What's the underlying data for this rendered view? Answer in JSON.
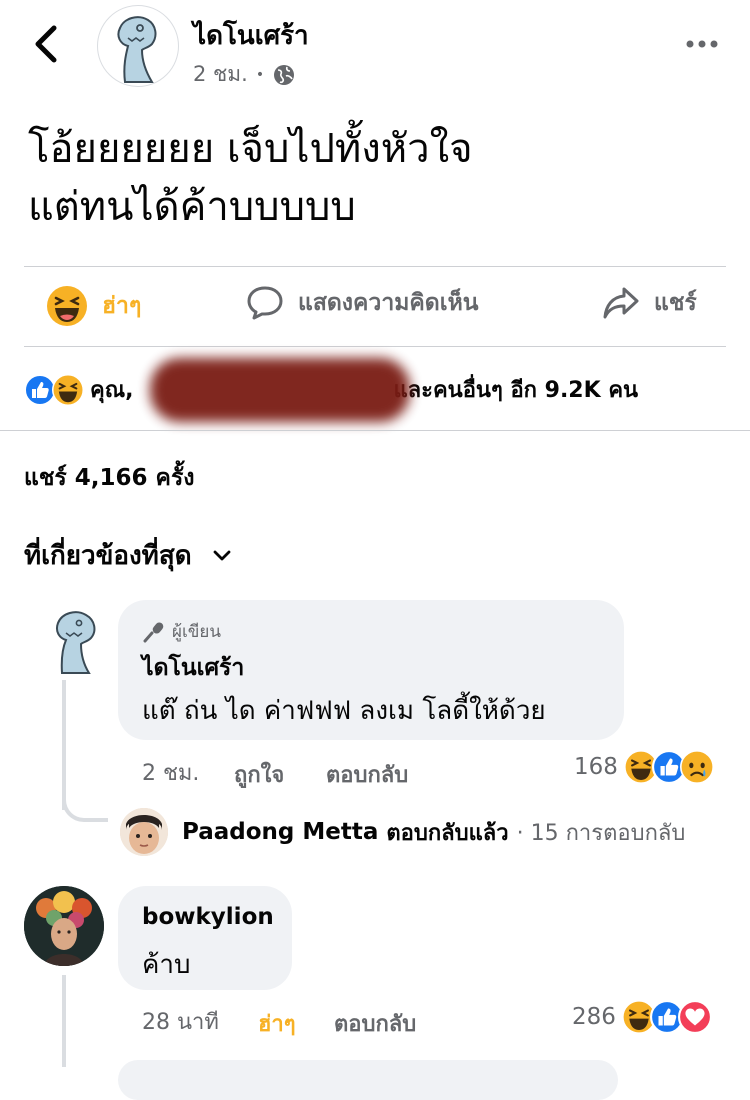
{
  "header": {
    "page_name": "ไดโนเศร้า",
    "time": "2 ชม.",
    "dot": "•"
  },
  "post": {
    "text": "โอ้ยยยยยย เจ็บไปทั้งหัวใจ\nแต่ทนได้ค้าบบบบบ"
  },
  "actions": {
    "haha_label": "ฮ่าๆ",
    "comment_label": "แสดงความคิดเห็น",
    "share_label": "แชร์"
  },
  "reactions_summary": {
    "you": "คุณ,",
    "others": "และคนอื่นๆ อีก 9.2K คน"
  },
  "shares": {
    "text": "แชร์ 4,166 ครั้ง"
  },
  "sort": {
    "label": "ที่เกี่ยวข้องที่สุด"
  },
  "comments": [
    {
      "badge": "ผู้เขียน",
      "author": "ไดโนเศร้า",
      "text": "แต๊ ถ่น ได ค่าฟฟฟ ลงเม โลดี้ให้ด้วย",
      "time": "2 ชม.",
      "like_label": "ถูกใจ",
      "reply_label": "ตอบกลับ",
      "reaction_count": "168",
      "reply_summary": {
        "name": "Paadong Metta",
        "action": "ตอบกลับแล้ว",
        "count": "· 15 การตอบกลับ"
      }
    },
    {
      "author": "bowkylion",
      "text": "ค้าบ",
      "time": "28 นาที",
      "like_label": "ฮ่าๆ",
      "reply_label": "ตอบกลับ",
      "reaction_count": "286"
    }
  ],
  "colors": {
    "haha": "#f7b125",
    "like": "#1877f2",
    "love": "#f33e58",
    "secondary_text": "#65676b"
  }
}
